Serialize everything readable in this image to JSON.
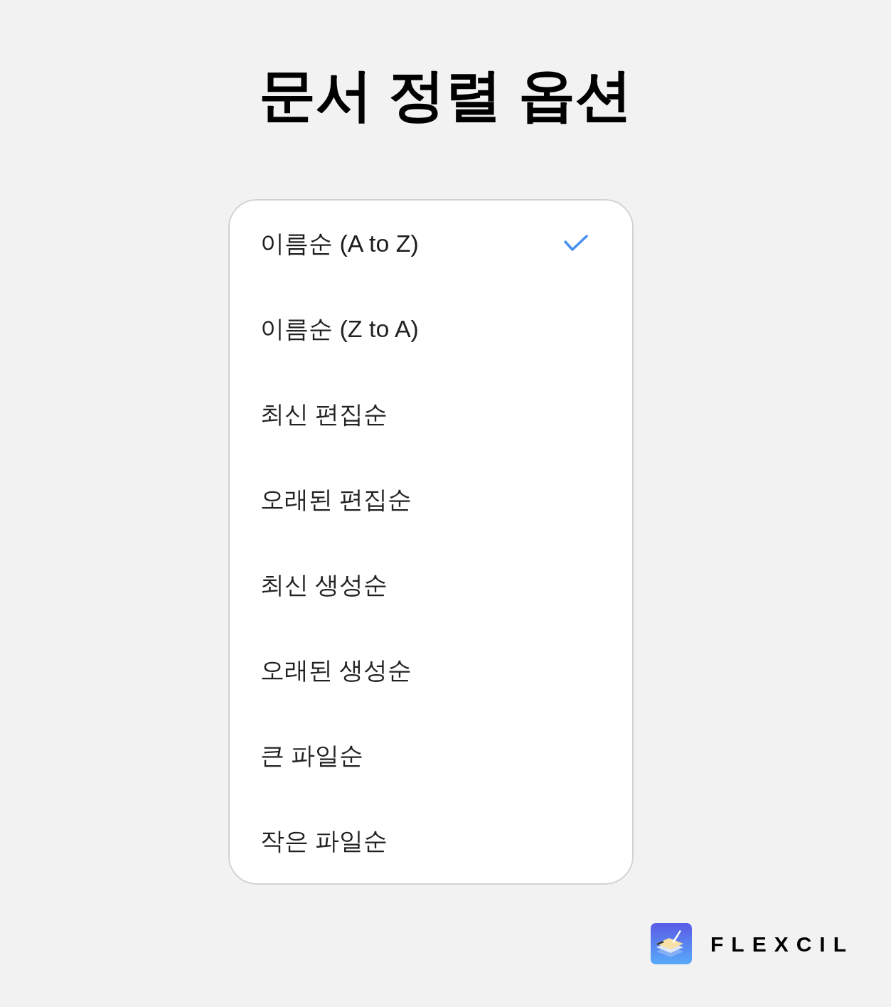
{
  "title": "문서 정렬 옵션",
  "sort_options": [
    {
      "label": "이름순 (A to Z)",
      "selected": true
    },
    {
      "label": "이름순 (Z to A)",
      "selected": false
    },
    {
      "label": "최신 편집순",
      "selected": false
    },
    {
      "label": "오래된 편집순",
      "selected": false
    },
    {
      "label": "최신 생성순",
      "selected": false
    },
    {
      "label": "오래된 생성순",
      "selected": false
    },
    {
      "label": "큰 파일순",
      "selected": false
    },
    {
      "label": "작은 파일순",
      "selected": false
    }
  ],
  "brand": {
    "name": "FLEXCIL"
  }
}
